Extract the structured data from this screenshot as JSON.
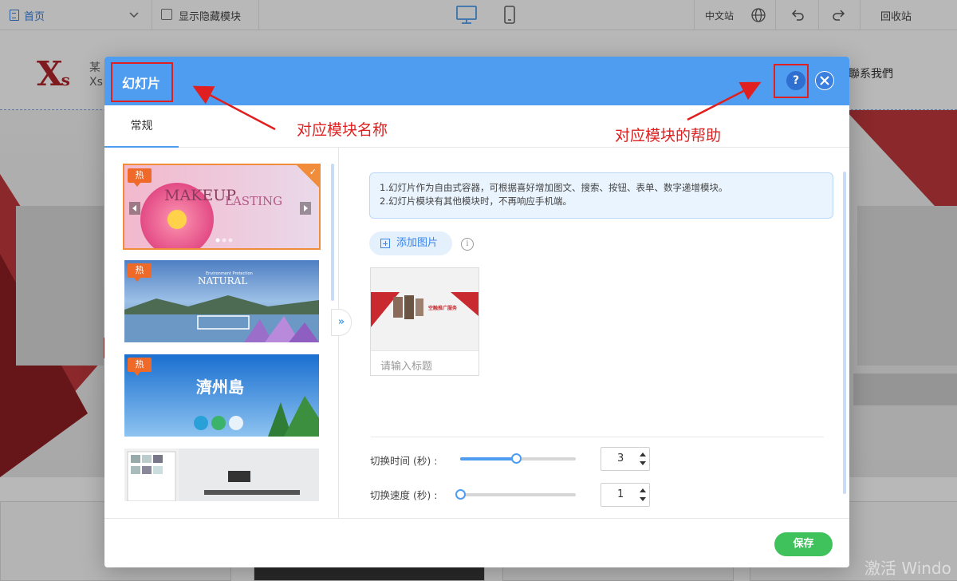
{
  "toolbar": {
    "home_label": "首页",
    "show_hidden_label": "显示隐藏模块",
    "lang_label": "中文站",
    "recycle_label": "回收站"
  },
  "site": {
    "logo_main": "X",
    "logo_sub": "s",
    "brand_line1": "某",
    "brand_line2": "Xs",
    "nav_contact": "聯系我們",
    "watermark": "激活 Windo"
  },
  "modal": {
    "title": "幻灯片",
    "help_label": "?",
    "tab_general": "常规",
    "expand_label": "»",
    "hot_label": "热",
    "selected_check": "✓",
    "thumbnails": [
      {
        "text1": "MAKEUP",
        "text2": "LASTING",
        "hot": true
      },
      {
        "text1": "NATURAL",
        "text2": "Environment Protection",
        "hot": true
      },
      {
        "text1": "濟州島",
        "text2": "",
        "hot": true
      },
      {
        "text1": "",
        "text2": "",
        "hot": false
      }
    ],
    "notice": {
      "line1": "1.幻灯片作为自由式容器，可根据喜好增加图文、搜索、按钮、表单、数字递增模块。",
      "line2": "2.幻灯片模块有其他模块时，不再响应手机端。"
    },
    "add_image_label": "添加图片",
    "info_label": "i",
    "image_card": {
      "pic_text": "空融推广服务",
      "title_placeholder": "请输入标题"
    },
    "settings": {
      "switch_time_label": "切换时间 (秒) :",
      "switch_time_value": "3",
      "switch_time_fraction": 0.48,
      "switch_speed_label": "切换速度 (秒) :",
      "switch_speed_value": "1",
      "switch_speed_fraction": 0.0
    },
    "save_label": "保存"
  },
  "annotations": {
    "module_name": "对应模块名称",
    "module_help": "对应模块的帮助"
  },
  "colors": {
    "accent": "#4e9df0",
    "save": "#3fc25c",
    "hot": "#ef6a28",
    "annotation": "#e02020"
  }
}
